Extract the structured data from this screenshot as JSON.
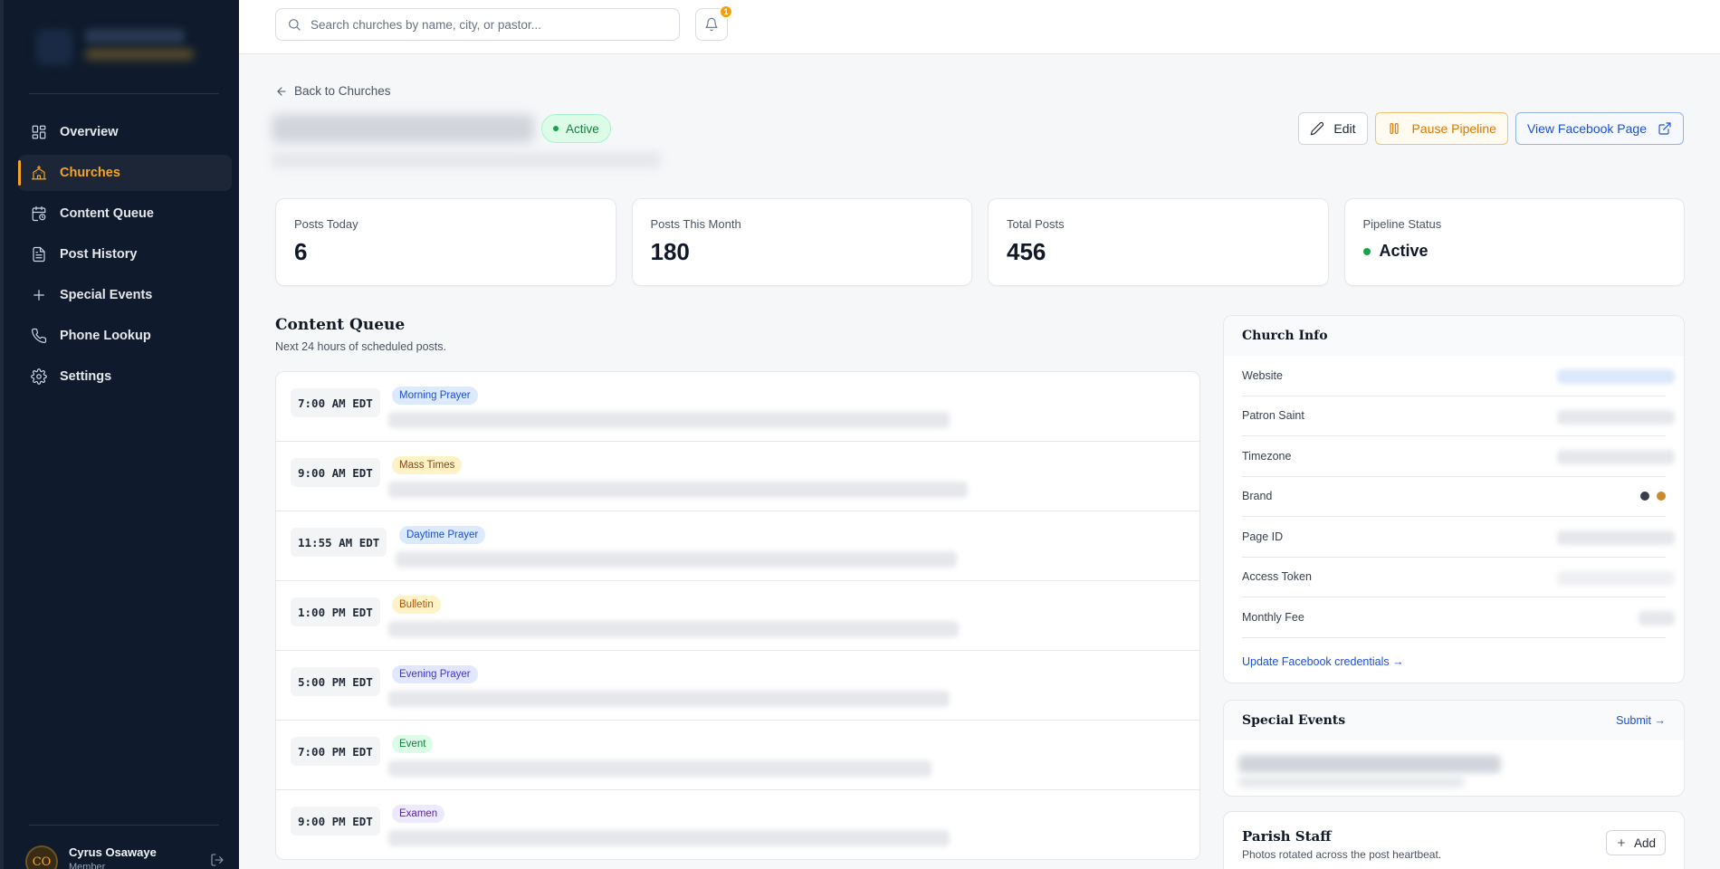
{
  "sidebar": {
    "items": [
      {
        "label": "Overview",
        "icon": "overview-icon"
      },
      {
        "label": "Churches",
        "icon": "church-icon",
        "active": true
      },
      {
        "label": "Content Queue",
        "icon": "calendar-clock-icon"
      },
      {
        "label": "Post History",
        "icon": "document-icon"
      },
      {
        "label": "Special Events",
        "icon": "plus-icon"
      },
      {
        "label": "Phone Lookup",
        "icon": "phone-icon"
      },
      {
        "label": "Settings",
        "icon": "gear-icon"
      }
    ],
    "user": {
      "initials": "CO",
      "name": "Cyrus Osawaye",
      "role": "Member"
    }
  },
  "topbar": {
    "search_placeholder": "Search churches by name, city, or pastor...",
    "notification_count": "1"
  },
  "page": {
    "back_label": "Back to Churches",
    "status": "Active",
    "actions": {
      "edit": "Edit",
      "pause": "Pause Pipeline",
      "facebook": "View Facebook Page"
    }
  },
  "stats": [
    {
      "label": "Posts Today",
      "value": "6"
    },
    {
      "label": "Posts This Month",
      "value": "180"
    },
    {
      "label": "Total Posts",
      "value": "456"
    },
    {
      "label": "Pipeline Status",
      "value": "Active"
    }
  ],
  "content_queue": {
    "title": "Content Queue",
    "subtitle": "Next 24 hours of scheduled posts.",
    "items": [
      {
        "time": "7:00 AM EDT",
        "tag": "Morning Prayer"
      },
      {
        "time": "9:00 AM EDT",
        "tag": "Mass Times"
      },
      {
        "time": "11:55 AM EDT",
        "tag": "Daytime Prayer"
      },
      {
        "time": "1:00 PM EDT",
        "tag": "Bulletin"
      },
      {
        "time": "5:00 PM EDT",
        "tag": "Evening Prayer"
      },
      {
        "time": "7:00 PM EDT",
        "tag": "Event"
      },
      {
        "time": "9:00 PM EDT",
        "tag": "Examen"
      }
    ]
  },
  "church_info": {
    "title": "Church Info",
    "rows": [
      "Website",
      "Patron Saint",
      "Timezone",
      "Brand",
      "Page ID",
      "Access Token",
      "Monthly Fee"
    ],
    "brand_colors": [
      "#3a3f47",
      "#c98a2b"
    ],
    "update_link": "Update Facebook credentials →"
  },
  "special_events": {
    "title": "Special Events",
    "submit": "Submit →"
  },
  "parish_staff": {
    "title": "Parish Staff",
    "subtitle": "Photos rotated across the post heartbeat.",
    "add_label": "Add"
  },
  "colors": {
    "accent": "#f5a524",
    "sidebar_bg": "#0f1b2d",
    "success": "#16a34a",
    "link": "#1d4ed8"
  }
}
